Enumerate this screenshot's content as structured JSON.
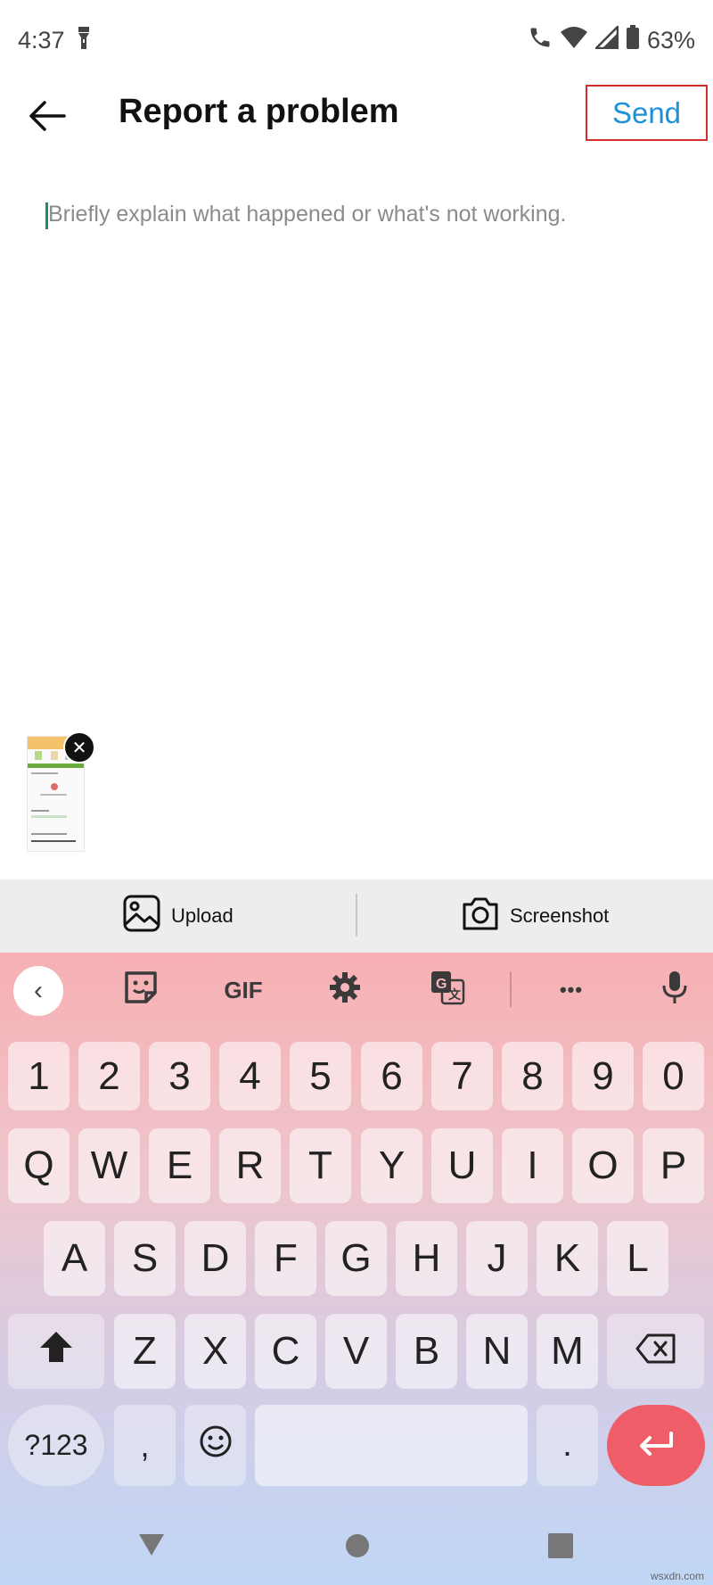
{
  "status_bar": {
    "time": "4:37",
    "battery": "63%",
    "icons": [
      "flashlight-icon",
      "call-icon",
      "wifi-icon",
      "signal-icon",
      "battery-icon"
    ]
  },
  "header": {
    "title": "Report a problem",
    "send_label": "Send",
    "back_icon": "arrow-left-icon"
  },
  "composer": {
    "placeholder": "Briefly explain what happened or what's not working."
  },
  "attachments": {
    "upload_label": "Upload",
    "screenshot_label": "Screenshot"
  },
  "keyboard": {
    "toolbar": [
      "chevron-left-icon",
      "sticker-icon",
      "GIF",
      "settings-icon",
      "translate-icon",
      "more-icon",
      "mic-icon"
    ],
    "gif_label": "GIF",
    "more_label": "•••",
    "row_numbers": [
      "1",
      "2",
      "3",
      "4",
      "5",
      "6",
      "7",
      "8",
      "9",
      "0"
    ],
    "row_1": [
      "Q",
      "W",
      "E",
      "R",
      "T",
      "Y",
      "U",
      "I",
      "O",
      "P"
    ],
    "row_2": [
      "A",
      "S",
      "D",
      "F",
      "G",
      "H",
      "J",
      "K",
      "L"
    ],
    "row_3": [
      "Z",
      "X",
      "C",
      "V",
      "B",
      "N",
      "M"
    ],
    "symbols_label": "?123",
    "comma_label": ",",
    "period_label": ".",
    "emoji_label": "☺"
  },
  "colors": {
    "accent": "#1d91d8",
    "highlight_border": "#d42b2b",
    "enter_key": "#ef5d69"
  },
  "watermark": "wsxdn.com"
}
